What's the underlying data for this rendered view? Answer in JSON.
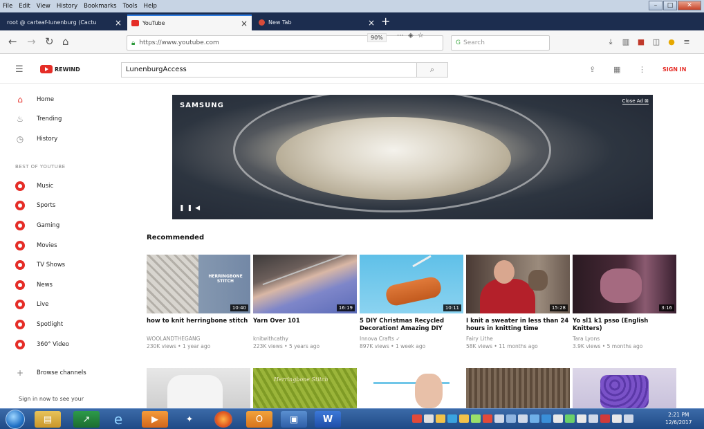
{
  "menubar": {
    "items": [
      "File",
      "Edit",
      "View",
      "History",
      "Bookmarks",
      "Tools",
      "Help"
    ]
  },
  "tabs": [
    {
      "label": "root @ carteaf-lunenburg (Cactu",
      "active": false
    },
    {
      "label": "YouTube",
      "active": true
    },
    {
      "label": "New Tab",
      "active": false
    }
  ],
  "navbar": {
    "url": "https://www.youtube.com",
    "zoom": "90%",
    "search_placeholder": "Search"
  },
  "yt": {
    "logo_text": "REWIND",
    "search_value": "LunenburgAccess",
    "sign_in": "SIGN IN"
  },
  "sidebar": {
    "main_items": [
      "Home",
      "Trending",
      "History"
    ],
    "section_header": "BEST OF YOUTUBE",
    "best_items": [
      "Music",
      "Sports",
      "Gaming",
      "Movies",
      "TV Shows",
      "News",
      "Live",
      "Spotlight",
      "360° Video"
    ],
    "browse": "Browse channels",
    "signin_note": "Sign in now to see your"
  },
  "ad": {
    "brand": "SAMSUNG",
    "close_label": "Close Ad ⊠"
  },
  "recommended": {
    "header": "Recommended",
    "videos": [
      {
        "title": "how to knit herringbone stitch",
        "channel": "WOOLANDTHEGANG",
        "meta": "230K views • 1 year ago",
        "duration": "10:40",
        "thumb_text": "HERRINGBONE STITCH"
      },
      {
        "title": "Yarn Over 101",
        "channel": "knitwithcathy",
        "meta": "223K views • 5 years ago",
        "duration": "16:19",
        "thumb_text": ""
      },
      {
        "title": "5 DIY Christmas Recycled Decoration! Amazing DIY",
        "channel": "Innova Crafts ✓",
        "meta": "897K views • 1 week ago",
        "duration": "10:11",
        "thumb_text": ""
      },
      {
        "title": "I knit a sweater in less than 24 hours in knitting time",
        "channel": "Fairy Lithe",
        "meta": "58K views • 11 months ago",
        "duration": "15:28",
        "thumb_text": ""
      },
      {
        "title": "Yo sl1 k1 psso (English Knitters)",
        "channel": "Tara Lyons",
        "meta": "3.9K views • 5 months ago",
        "duration": "3:16",
        "thumb_text": ""
      }
    ],
    "row2_thumb_text": "Herringbone Stitch"
  },
  "taskbar": {
    "time": "2:21 PM",
    "date": "12/6/2017"
  },
  "colors": {
    "yt_red": "#e52d27",
    "tab_bg": "#1c2d4f",
    "taskbar": "#1f4a86"
  }
}
